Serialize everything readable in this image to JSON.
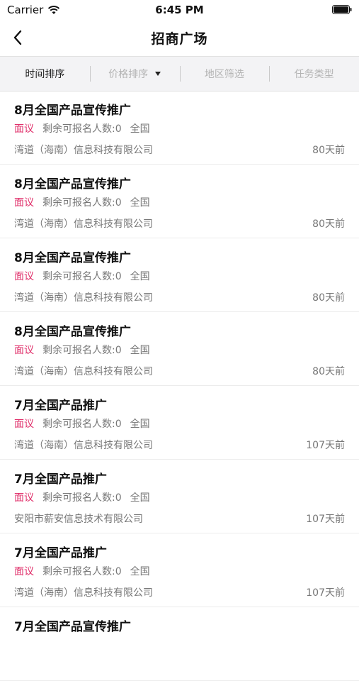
{
  "status_bar": {
    "carrier": "Carrier",
    "time": "6:45 PM"
  },
  "nav": {
    "title": "招商广场",
    "back_icon": "chevron-left-icon"
  },
  "filters": [
    {
      "label": "时间排序",
      "active": true
    },
    {
      "label": "价格排序",
      "active": false
    },
    {
      "label": "地区筛选",
      "active": false
    },
    {
      "label": "任务类型",
      "active": false
    }
  ],
  "items": [
    {
      "title": "8月全国产品宣传推广",
      "tag": "面议",
      "remaining": "剩余可报名人数:0",
      "region": "全国",
      "company": "湾道（海南）信息科技有限公司",
      "time": "80天前"
    },
    {
      "title": "8月全国产品宣传推广",
      "tag": "面议",
      "remaining": "剩余可报名人数:0",
      "region": "全国",
      "company": "湾道（海南）信息科技有限公司",
      "time": "80天前"
    },
    {
      "title": "8月全国产品宣传推广",
      "tag": "面议",
      "remaining": "剩余可报名人数:0",
      "region": "全国",
      "company": "湾道（海南）信息科技有限公司",
      "time": "80天前"
    },
    {
      "title": "8月全国产品宣传推广",
      "tag": "面议",
      "remaining": "剩余可报名人数:0",
      "region": "全国",
      "company": "湾道（海南）信息科技有限公司",
      "time": "80天前"
    },
    {
      "title": "7月全国产品推广",
      "tag": "面议",
      "remaining": "剩余可报名人数:0",
      "region": "全国",
      "company": "湾道（海南）信息科技有限公司",
      "time": "107天前"
    },
    {
      "title": "7月全国产品推广",
      "tag": "面议",
      "remaining": "剩余可报名人数:0",
      "region": "全国",
      "company": "安阳市薪安信息技术有限公司",
      "time": "107天前"
    },
    {
      "title": "7月全国产品推广",
      "tag": "面议",
      "remaining": "剩余可报名人数:0",
      "region": "全国",
      "company": "湾道（海南）信息科技有限公司",
      "time": "107天前"
    },
    {
      "title": "7月全国产品宣传推广",
      "tag": "",
      "remaining": "",
      "region": "",
      "company": "",
      "time": ""
    }
  ],
  "colors": {
    "accent": "#e0306b",
    "filter_bg": "#f3f3f5"
  }
}
